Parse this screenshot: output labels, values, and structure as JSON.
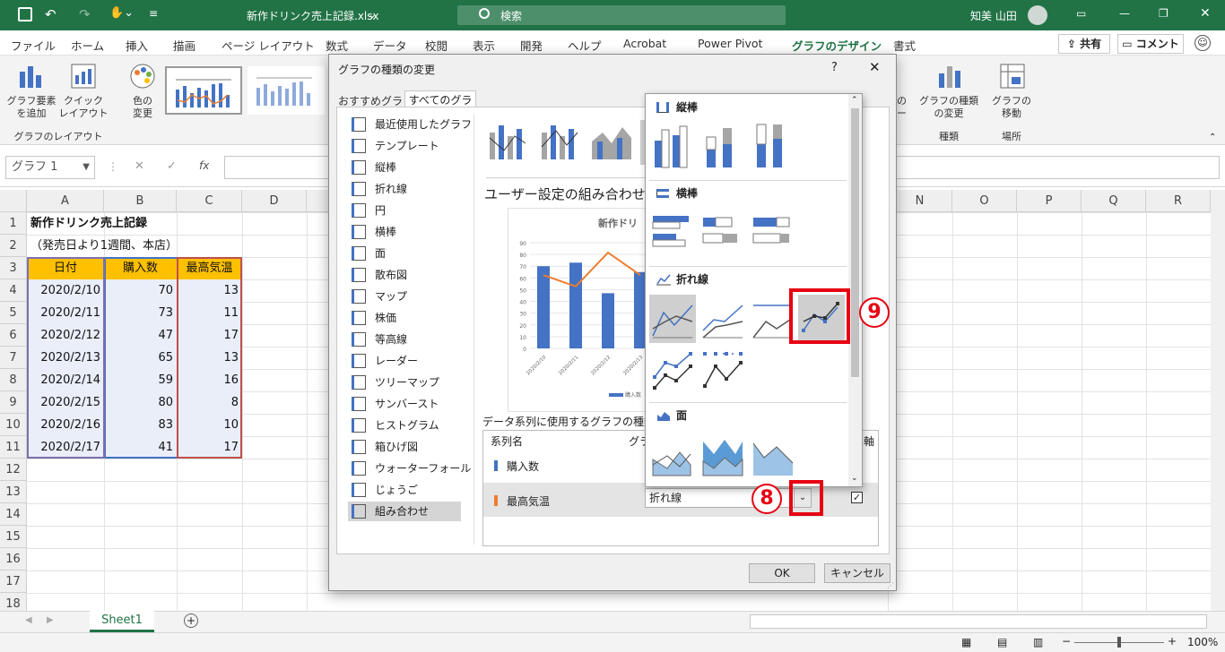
{
  "window": {
    "file_title": "新作ドリンク売上記録.xlsx",
    "search_placeholder": "検索",
    "user": "知美 山田"
  },
  "menu": [
    "ファイル",
    "ホーム",
    "挿入",
    "描画",
    "ページ レイアウト",
    "数式",
    "データ",
    "校閲",
    "表示",
    "開発",
    "ヘルプ",
    "Acrobat",
    "Power Pivot",
    "グラフのデザイン",
    "書式"
  ],
  "menu_active": "グラフのデザイン",
  "share_label": "共有",
  "comment_label": "コメント",
  "ribbon": {
    "add_element": "グラフ要素\nを追加",
    "quick_layout": "クイック\nレイアウト",
    "colors": "色の\n変更",
    "group_layout": "グラフのレイアウト",
    "change_type": "グラフの種類\nの変更",
    "move_chart": "グラフの\n移動",
    "group_type": "種類",
    "group_location": "場所",
    "partial_data": "の",
    "partial_data2": "ー"
  },
  "formula_bar": {
    "name_box": "グラフ 1",
    "fx": "fx"
  },
  "columns": [
    "A",
    "B",
    "C",
    "D",
    "N",
    "O",
    "P",
    "Q",
    "R"
  ],
  "rows": [
    "1",
    "2",
    "3",
    "4",
    "5",
    "6",
    "7",
    "8",
    "9",
    "10",
    "11",
    "12",
    "13",
    "14",
    "15",
    "16",
    "17",
    "18"
  ],
  "sheet": {
    "title": "新作ドリンク売上記録",
    "subtitle": "（発売日より1週間、本店）",
    "headers": [
      "日付",
      "購入数",
      "最高気温"
    ],
    "data": [
      [
        "2020/2/10",
        "70",
        "13"
      ],
      [
        "2020/2/11",
        "73",
        "11"
      ],
      [
        "2020/2/12",
        "47",
        "17"
      ],
      [
        "2020/2/13",
        "65",
        "13"
      ],
      [
        "2020/2/14",
        "59",
        "16"
      ],
      [
        "2020/2/15",
        "80",
        "8"
      ],
      [
        "2020/2/16",
        "83",
        "10"
      ],
      [
        "2020/2/17",
        "41",
        "17"
      ]
    ]
  },
  "sheet_tab": "Sheet1",
  "zoom": "100%",
  "dialog": {
    "title": "グラフの種類の変更",
    "help": "?",
    "tab_recommended": "おすすめグラフ",
    "tab_all": "すべてのグラフ",
    "chart_types": [
      "最近使用したグラフ",
      "テンプレート",
      "縦棒",
      "折れ線",
      "円",
      "横棒",
      "面",
      "散布図",
      "マップ",
      "株価",
      "等高線",
      "レーダー",
      "ツリーマップ",
      "サンバースト",
      "ヒストグラム",
      "箱ひげ図",
      "ウォーターフォール",
      "じょうご",
      "組み合わせ"
    ],
    "selected_type": "組み合わせ",
    "combo_heading": "ユーザー設定の組み合わせ",
    "preview_title": "新作ドリ",
    "preview_legend": "購入数",
    "series_caption": "データ系列に使用するグラフの種類と軸",
    "col_series": "系列名",
    "col_type": "グラ",
    "col_axis": "軸",
    "series": [
      {
        "name": "購入数",
        "color": "#4472c4"
      },
      {
        "name": "最高気温",
        "color": "#ed7d31",
        "type": "折れ線",
        "secondary_axis": true
      }
    ],
    "ok": "OK",
    "cancel": "キャンセル"
  },
  "popup": {
    "sections": [
      "縦棒",
      "横棒",
      "折れ線",
      "面"
    ]
  },
  "annotations": {
    "step8": "8",
    "step9": "9"
  },
  "chart_data": {
    "type": "bar",
    "title": "新作ドリ",
    "categories": [
      "2020/2/10",
      "2020/2/11",
      "2020/2/12",
      "2020/2/13"
    ],
    "series": [
      {
        "name": "購入数",
        "values": [
          70,
          73,
          47,
          65
        ]
      },
      {
        "values": [
          13,
          11,
          17,
          13
        ]
      }
    ],
    "ylim": [
      0,
      90
    ],
    "y_ticks": [
      "0",
      "10",
      "20",
      "30",
      "40",
      "50",
      "60",
      "70",
      "80",
      "90"
    ]
  },
  "colors": {
    "excel_green": "#217346",
    "header_orange": "#ffc000",
    "bar_blue": "#4472c4",
    "line_orange": "#ed7d31",
    "highlight_red": "#e60012"
  }
}
